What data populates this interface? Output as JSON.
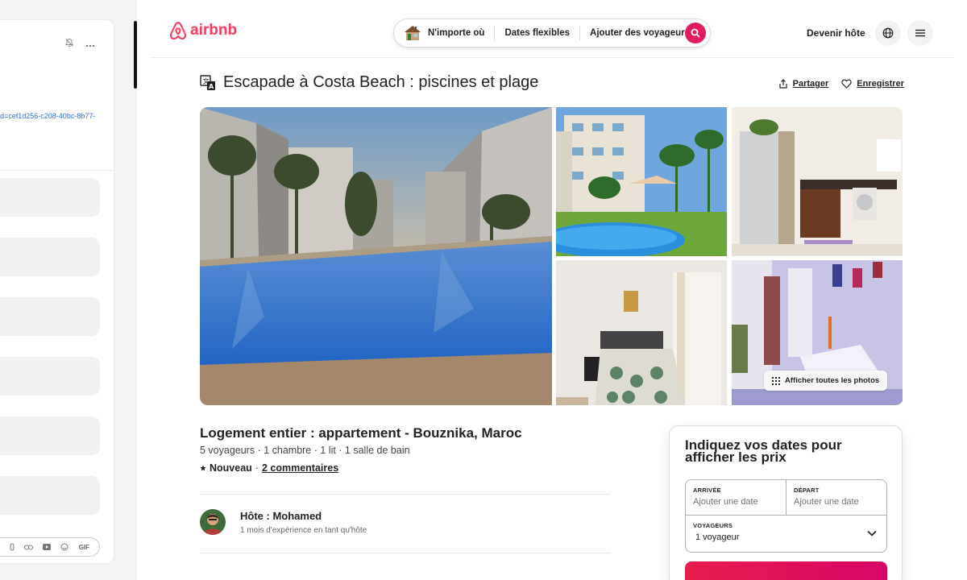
{
  "left_panel": {
    "link_text": "d=cef1d256-c208-40bc-8b77-",
    "toolbar_gif": "GIF"
  },
  "header": {
    "logo_text": "airbnb",
    "search": {
      "where": "N'importe où",
      "dates": "Dates flexibles",
      "guests": "Ajouter des voyageurs"
    },
    "host_link": "Devenir hôte"
  },
  "listing": {
    "title": "Escapade à Costa Beach : piscines et plage",
    "share_label": "Partager",
    "save_label": "Enregistrer",
    "show_all_photos": "Afficher toutes les photos",
    "subtitle": "Logement entier : appartement - Bouznika, Maroc",
    "specs": "5 voyageurs · 1 chambre · 1 lit · 1 salle de bain",
    "rating_badge": "Nouveau",
    "rating_separator": "·",
    "reviews_link": "2 commentaires",
    "host_name": "Hôte : Mohamed",
    "host_experience": "1 mois d'expérience en tant qu'hôte"
  },
  "booking": {
    "title": "Indiquez vos dates pour afficher les prix",
    "checkin_label": "ARRIVÉE",
    "checkin_placeholder": "Ajouter une date",
    "checkout_label": "DÉPART",
    "checkout_placeholder": "Ajouter une date",
    "guests_label": "VOYAGEURS",
    "guests_value": "1 voyageur"
  },
  "colors": {
    "brand": "#ff385c",
    "search_button": "#e31c5f"
  },
  "icons": [
    "bell-icon",
    "more-icon",
    "house-icon",
    "search-icon",
    "globe-icon",
    "hamburger-icon",
    "translate-icon",
    "share-icon",
    "heart-icon",
    "grid-icon",
    "star-icon",
    "chevron-down-icon"
  ]
}
